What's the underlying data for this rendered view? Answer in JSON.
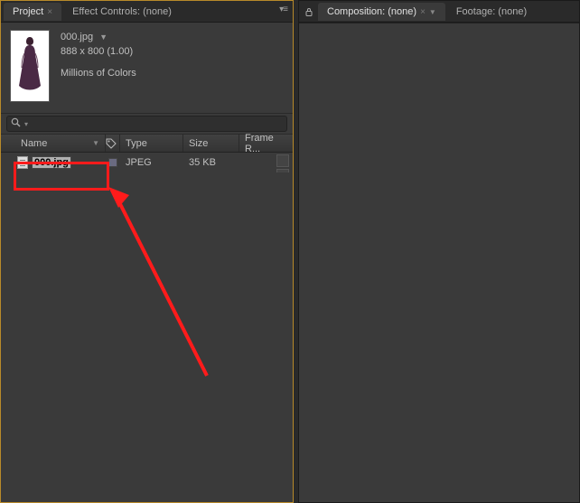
{
  "left": {
    "tabs": [
      {
        "label": "Project",
        "active": true,
        "closeable": true
      },
      {
        "label": "Effect Controls: (none)",
        "active": false,
        "closeable": false
      }
    ],
    "asset": {
      "name": "000.jpg",
      "dimensions": "888 x 800 (1.00)",
      "colors": "Millions of Colors"
    },
    "search": {
      "placeholder": ""
    },
    "columns": {
      "name": "Name",
      "type": "Type",
      "size": "Size",
      "frame": "Frame R..."
    },
    "rows": [
      {
        "name": "000.jpg",
        "type": "JPEG",
        "size": "35 KB"
      }
    ]
  },
  "right": {
    "tabs": [
      {
        "label": "Composition: (none)",
        "active": true,
        "closeable": true
      },
      {
        "label": "Footage: (none)",
        "active": false,
        "closeable": false
      }
    ]
  }
}
